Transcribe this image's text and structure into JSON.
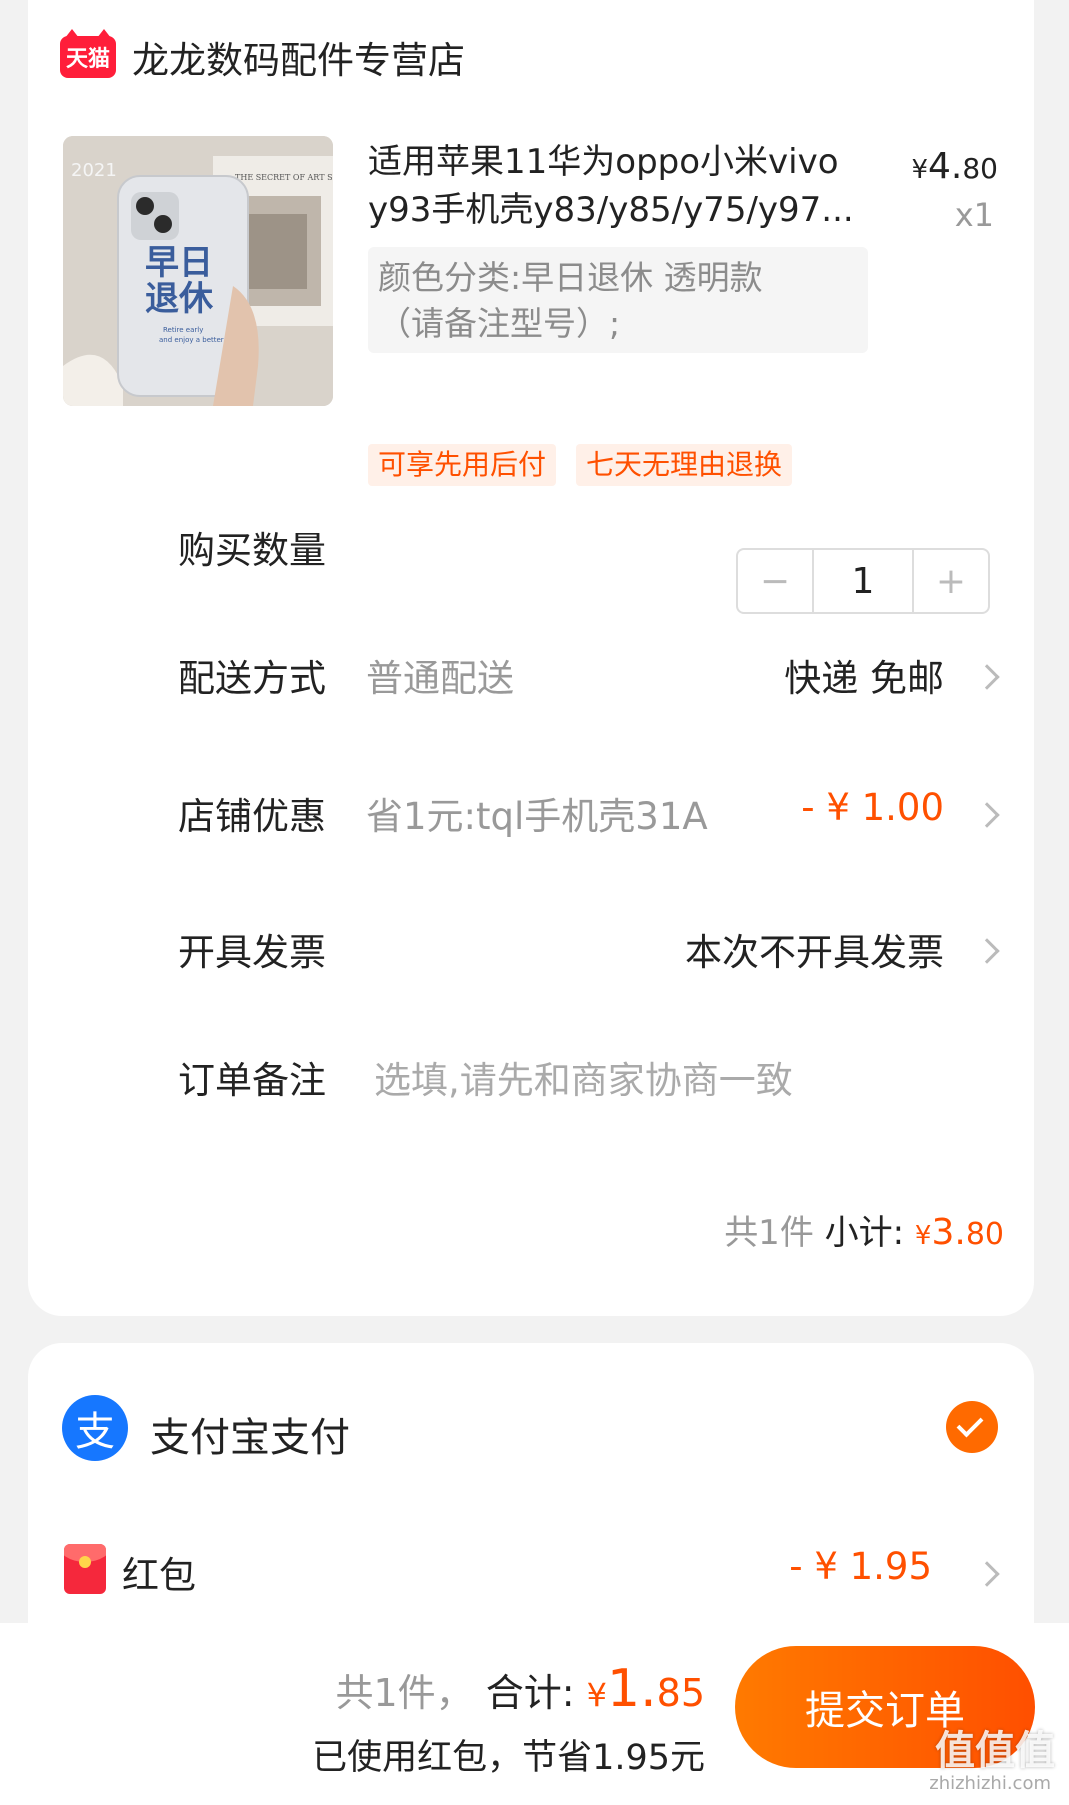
{
  "store": {
    "logo_text": "天猫",
    "name": "龙龙数码配件专营店"
  },
  "product": {
    "title_line1": "适用苹果11华为oppo小米vivo",
    "title_line2": "y93手机壳y83/y85/y75/y97...",
    "sku_line1": "颜色分类:早日退休  透明款",
    "sku_line2": "（请备注型号）;",
    "price_yen": "¥",
    "price_int": "4.",
    "price_dec": "80",
    "quantity_label": "x1",
    "image": {
      "year_text": "2021",
      "book_text": "THE SECRET OF ART SPACE",
      "big_text_1": "早日",
      "big_text_2": "退休",
      "small_text_1": "Retire early",
      "small_text_2": "and enjoy a better life"
    }
  },
  "tags": [
    "可享先用后付",
    "七天无理由退换"
  ],
  "rows": {
    "quantity": {
      "label": "购买数量",
      "minus": "−",
      "value": "1",
      "plus": "+"
    },
    "delivery": {
      "label": "配送方式",
      "sub": "普通配送",
      "value": "快递 免邮"
    },
    "discount": {
      "label": "店铺优惠",
      "sub": "省1元:tql手机壳31A",
      "value": "- ¥ 1.00"
    },
    "invoice": {
      "label": "开具发票",
      "value": "本次不开具发票"
    },
    "note": {
      "label": "订单备注",
      "placeholder": "选填,请先和商家协商一致"
    }
  },
  "subtotal": {
    "count": "共1件",
    "label": " 小计: ",
    "yen": "¥",
    "int": "3.",
    "dec": "80"
  },
  "payment": {
    "method": "支付宝支付",
    "alipay_glyph": "支",
    "red_packet_label": "红包",
    "red_packet_value": "- ¥ 1.95"
  },
  "bottom": {
    "count": "共1件，",
    "total_label": " 合计: ",
    "yen": "¥",
    "int": "1.",
    "dec": "85",
    "saved": "已使用红包，节省1.95元",
    "submit_label": "提交订单",
    "watermark": "值值值",
    "watermark_sub": "zhizhizhi.com"
  },
  "colors": {
    "accent": "#ff5000",
    "tmall_red": "#ff1e3a",
    "alipay_blue": "#1677ff"
  }
}
